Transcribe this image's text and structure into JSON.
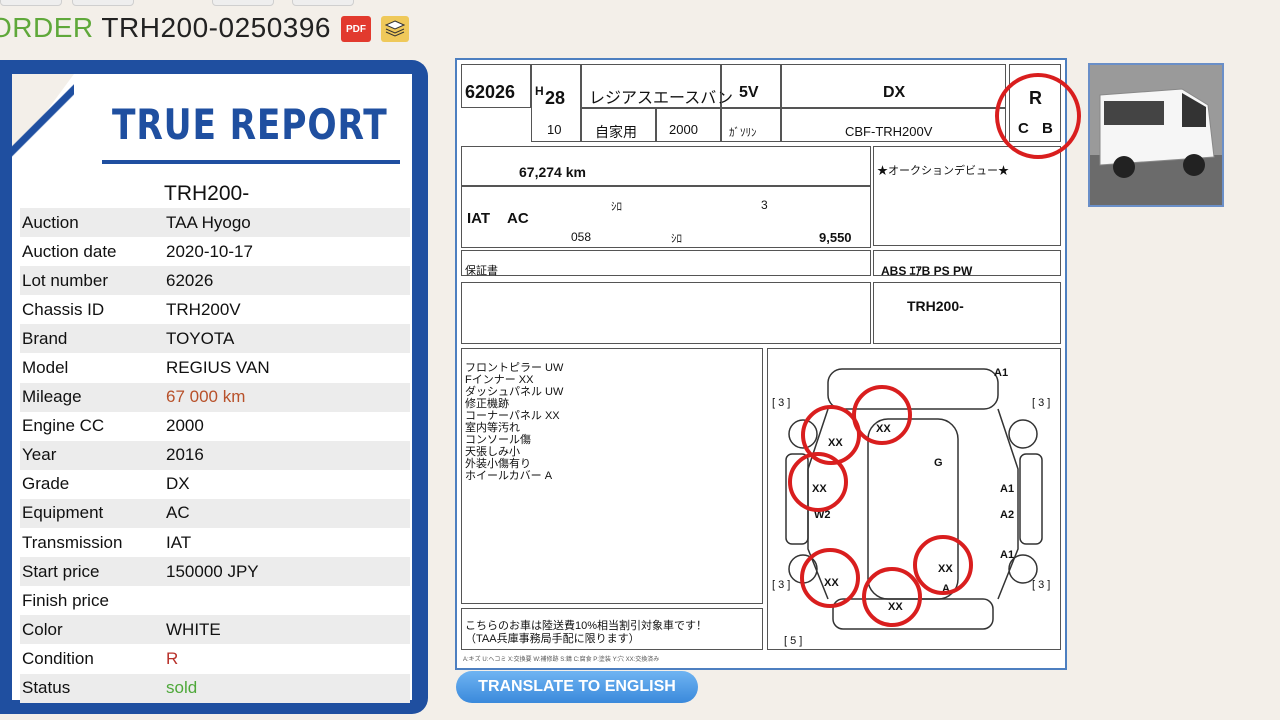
{
  "header": {
    "order_label": "ORDER",
    "order_number": "TRH200-0250396",
    "pdf_label": "PDF"
  },
  "report": {
    "title": "TRUE REPORT",
    "chassis_heading": "TRH200-",
    "rows": [
      {
        "key": "Auction",
        "value": "TAA Hyogo"
      },
      {
        "key": "Auction date",
        "value": "2020-10-17"
      },
      {
        "key": "Lot number",
        "value": "62026"
      },
      {
        "key": "Chassis ID",
        "value": "TRH200V"
      },
      {
        "key": "Brand",
        "value": "TOYOTA"
      },
      {
        "key": "Model",
        "value": "REGIUS VAN"
      },
      {
        "key": "Mileage",
        "value": "67 000 km"
      },
      {
        "key": "Engine CC",
        "value": "2000"
      },
      {
        "key": "Year",
        "value": "2016"
      },
      {
        "key": "Grade",
        "value": "DX"
      },
      {
        "key": "Equipment",
        "value": "AC"
      },
      {
        "key": "Transmission",
        "value": "IAT"
      },
      {
        "key": "Start price",
        "value": "150000 JPY"
      },
      {
        "key": "Finish price",
        "value": ""
      },
      {
        "key": "Color",
        "value": "WHITE"
      },
      {
        "key": "Condition",
        "value": "R"
      },
      {
        "key": "Status",
        "value": "sold"
      }
    ]
  },
  "sheet": {
    "lot": "62026",
    "era": "H",
    "year": "28",
    "car_name": "レジアスエースバン",
    "doors": "5V",
    "grade": "DX",
    "score": "R",
    "exterior": "C",
    "interior": "B",
    "month": "10",
    "usage": "自家用",
    "cc": "2000",
    "fuel": "ｶﾞｿﾘﾝ",
    "model_code": "CBF-TRH200V",
    "mileage": "67,274 km",
    "shift": "IAT",
    "ac": "AC",
    "color": "ｼﾛ",
    "seats": "3",
    "color_no": "058",
    "interior_color": "ｼﾛ",
    "recycle": "9,550",
    "sales_point": "★オークションデビュー★",
    "equipment": "ABS ｴｱB PS PW",
    "warranty": "保証書",
    "chassis_no": "TRH200-",
    "inspector_notes": [
      "フロントピラー UW",
      "Fインナー XX",
      "ダッシュパネル UW",
      "修正機跡",
      "コーナーパネル XX",
      "室内等汚れ",
      "コンソール傷",
      "天張しみ小",
      "外装小傷有り",
      "ホイールカバー A"
    ],
    "office_note_1": "こちらのお車は陸送費10%相当割引対象車です！",
    "office_note_2": "（TAA兵庫事務局手配に限ります）",
    "footer_code": "A:キズ U:ヘコミ X:交換要 W:補修跡 S:錆 C:腐食 P:塗装 Y:穴 XX:交換済み",
    "marks": {
      "a1_top": "A1",
      "bracket": "[ 3 ]",
      "g": "G",
      "w2": "W2",
      "a1": "A1",
      "a2": "A2",
      "a": "A",
      "bracket5": "[ 5 ]",
      "xx": "XX"
    }
  },
  "translate_button": "TRANSLATE TO ENGLISH"
}
